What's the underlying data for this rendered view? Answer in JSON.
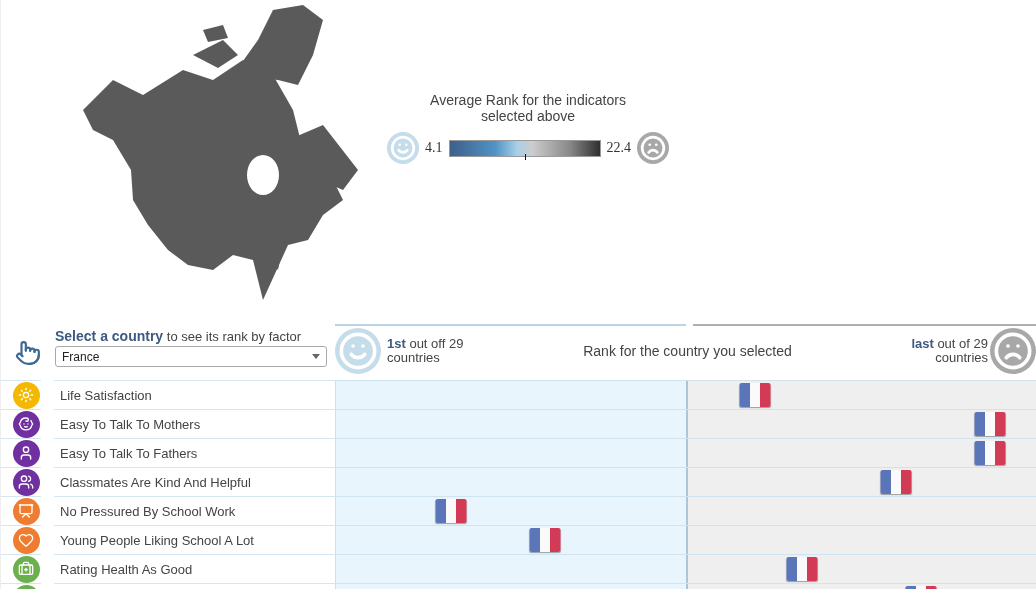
{
  "legend": {
    "title": "Average Rank for the indicators selected above",
    "min": "4.1",
    "max": "22.4",
    "level": 0.5
  },
  "selector": {
    "prompt": "**Select a country** to see its rank by factor",
    "value": "France"
  },
  "rank_header": {
    "best": "**1st** out off 29 countries",
    "title": "Rank for the country you selected",
    "worst": "**last** out of 29 countries"
  },
  "indicators": [
    {
      "label": "Life Satisfaction",
      "color": "#f5b800",
      "level": 0.599
    },
    {
      "label": "Easy To Talk To Mothers",
      "color": "#7030a0",
      "level": 0.934
    },
    {
      "label": "Easy To Talk To Fathers",
      "color": "#7030a0",
      "level": 0.934
    },
    {
      "label": "Classmates Are Kind And Helpful",
      "color": "#7030a0",
      "level": 0.8
    },
    {
      "label": "No Pressured By School Work",
      "color": "#ee7d31",
      "level": 0.164
    },
    {
      "label": "Young People Liking School A Lot",
      "color": "#ee7d31",
      "level": 0.298
    },
    {
      "label": "Rating Health As Good",
      "color": "#6ab04c",
      "level": 0.666
    },
    {
      "color": "#6ab04c",
      "level": 0.835
    }
  ]
}
